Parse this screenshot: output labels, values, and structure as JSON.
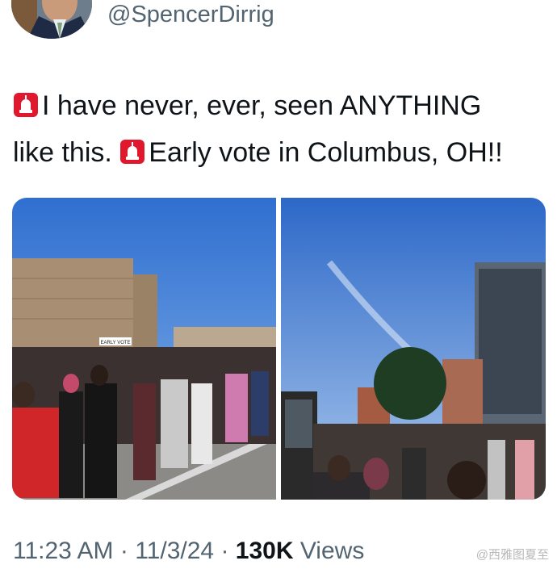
{
  "author": {
    "handle": "@SpencerDirrig",
    "avatar_icon": "profile-avatar"
  },
  "tweet": {
    "line1": "I have never, ever, seen ANYTHING",
    "line2_a": "like this.",
    "line2_b": "Early vote in Columbus, OH!!",
    "emoji_icon": "rotating-light-siren-icon"
  },
  "media": {
    "photos": [
      {
        "name": "photo-left",
        "sign_text": "EARLY VOTE"
      },
      {
        "name": "photo-right"
      }
    ]
  },
  "metadata": {
    "time": "11:23 AM",
    "sep1": "·",
    "date": "11/3/24",
    "sep2": "·",
    "views_count": "130K",
    "views_label": "Views"
  },
  "watermark": "@西雅图夏至",
  "colors": {
    "text": "#0f1419",
    "secondary": "#536471",
    "siren_red": "#e0182d"
  }
}
